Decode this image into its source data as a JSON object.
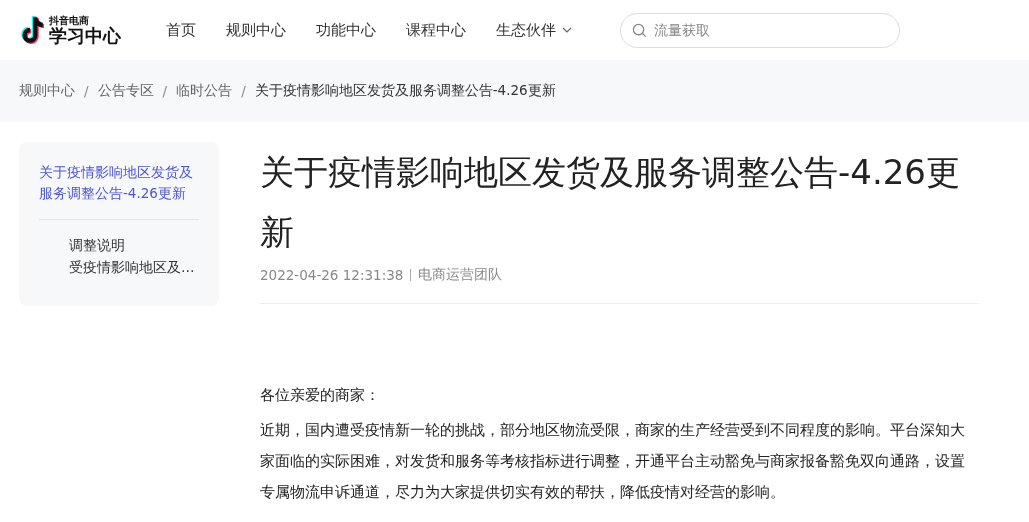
{
  "header": {
    "logo": {
      "small_text": "抖音电商",
      "title": "学习中心"
    },
    "nav": [
      {
        "label": "首页",
        "dropdown": false
      },
      {
        "label": "规则中心",
        "dropdown": false
      },
      {
        "label": "功能中心",
        "dropdown": false
      },
      {
        "label": "课程中心",
        "dropdown": false
      },
      {
        "label": "生态伙伴",
        "dropdown": true
      }
    ],
    "search": {
      "placeholder": "流量获取"
    }
  },
  "breadcrumb": [
    {
      "kind": "link",
      "label": "规则中心"
    },
    {
      "kind": "separator",
      "label": "/"
    },
    {
      "kind": "link",
      "label": "公告专区"
    },
    {
      "kind": "separator",
      "label": "/"
    },
    {
      "kind": "link",
      "label": "临时公告"
    },
    {
      "kind": "separator",
      "label": "/"
    },
    {
      "kind": "current",
      "label": "关于疫情影响地区发货及服务调整公告-4.26更新"
    }
  ],
  "toc": {
    "items": [
      {
        "label": "关于疫情影响地区发货及服务调整公告-4.26更新",
        "selected": true,
        "children": [
          {
            "label": "调整说明",
            "selected": false
          },
          {
            "label": "受疫情影响地区及…",
            "selected": false
          }
        ]
      }
    ]
  },
  "article": {
    "title": "关于疫情影响地区发货及服务调整公告-4.26更新",
    "date": "2022-04-26 12:31:38",
    "author": "电商运营团队",
    "paragraphs": [
      "各位亲爱的商家：",
      "近期，国内遭受疫情新一轮的挑战，部分地区物流受限，商家的生产经营受到不同程度的影响。平台深知大家面临的实际困难，对发货和服务等考核指标进行调整，开通平台主动豁免与商家报备豁免双向通路，设置专属物流申诉通道，尽力为大家提供切实有效的帮扶，降低疫情对经营的影响。"
    ]
  }
}
